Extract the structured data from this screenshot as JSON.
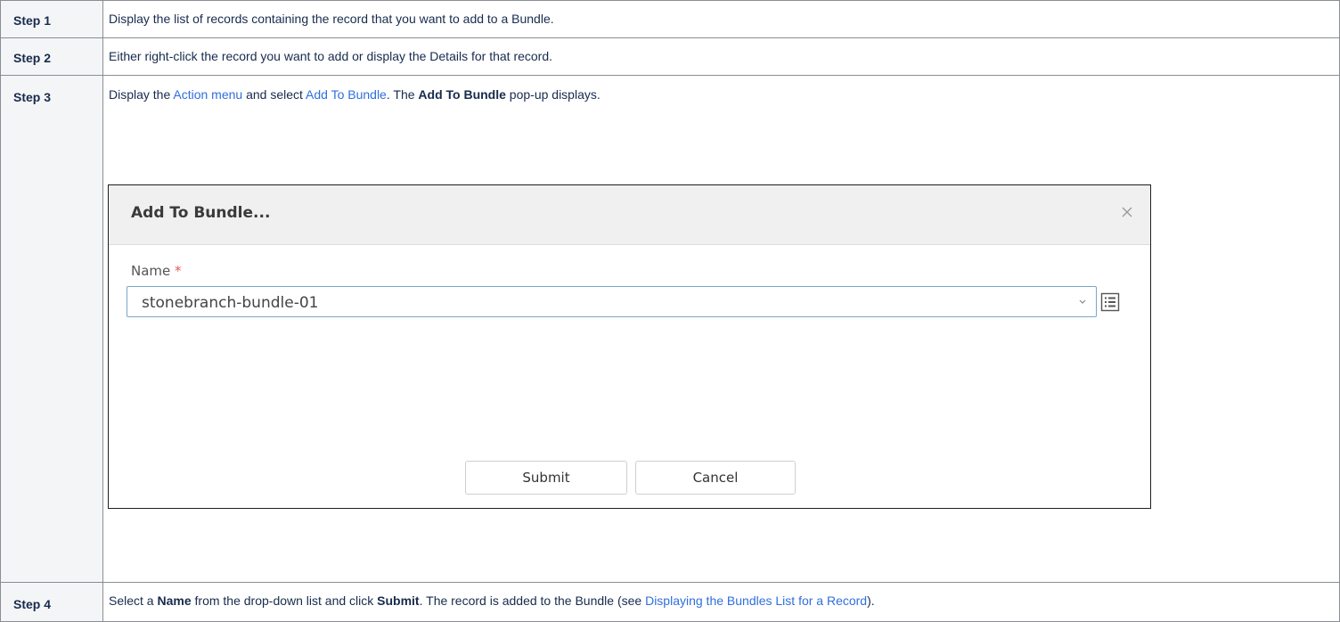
{
  "steps": [
    {
      "label": "Step 1",
      "text": "Display the list of records containing the record that you want to add to a Bundle."
    },
    {
      "label": "Step 2",
      "text": "Either right-click the record you want to add or display the Details for that record."
    },
    {
      "label": "Step 3",
      "text_before_link1": "Display the ",
      "link1": "Action menu",
      "text_between": " and select ",
      "link2": "Add To Bundle",
      "text_after_link2": ". The ",
      "bold": "Add To Bundle",
      "text_end": " pop-up displays."
    },
    {
      "label": "Step 4",
      "text1": "Select a ",
      "bold1": "Name",
      "text2": " from the drop-down list and click ",
      "bold2": "Submit",
      "text3": ". The record is added to the Bundle (see ",
      "link": "Displaying the Bundles List for a Record",
      "text4": ")."
    }
  ],
  "dialog": {
    "title": "Add To Bundle...",
    "close_icon": "close-icon",
    "field_label": "Name",
    "required_mark": "*",
    "field_value": "stonebranch-bundle-01",
    "submit_label": "Submit",
    "cancel_label": "Cancel"
  },
  "colors": {
    "link": "#2f6fde",
    "header_bg": "#f4f5f7",
    "required": "#e05a5a",
    "input_border": "#7aa7c7"
  }
}
